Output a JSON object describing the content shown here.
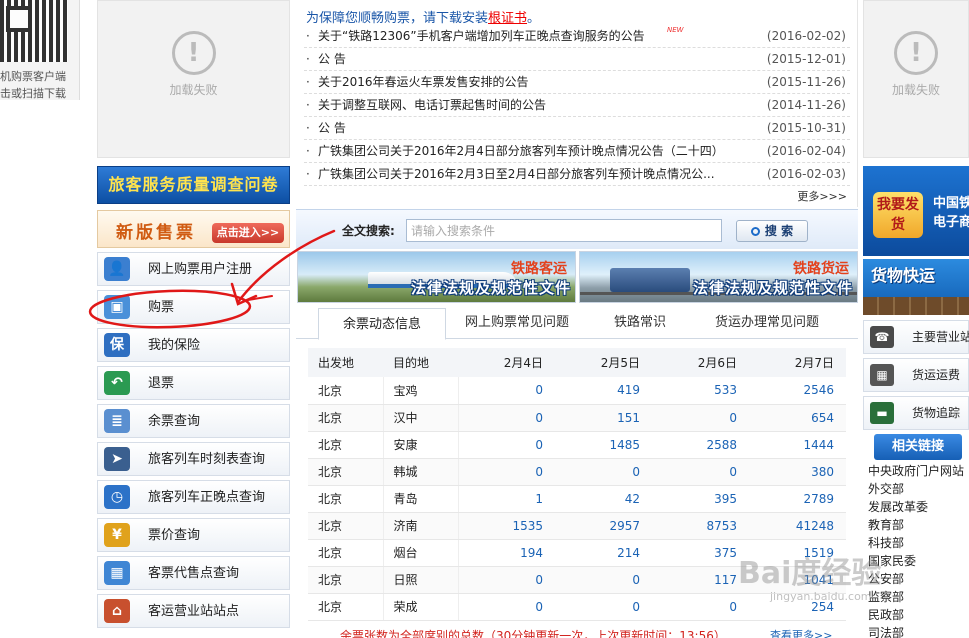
{
  "qr": {
    "line1": "机购票客户端",
    "line2": "击或扫描下载"
  },
  "load_failed": {
    "text": "加载失败",
    "glyph": "!"
  },
  "notice": {
    "headline_prefix": "为保障您顺畅购票，请下载安装",
    "headline_link": "根证书",
    "headline_suffix": "。",
    "items": [
      {
        "title": "关于“铁路12306”手机客户端增加列车正晚点查询服务的公告",
        "date": "(2016-02-02)",
        "new": "NEW"
      },
      {
        "title": "公 告",
        "date": "(2015-12-01)"
      },
      {
        "title": "关于2016年春运火车票发售安排的公告",
        "date": "(2015-11-26)"
      },
      {
        "title": "关于调整互联网、电话订票起售时间的公告",
        "date": "(2014-11-26)"
      },
      {
        "title": "公 告",
        "date": "(2015-10-31)"
      },
      {
        "title": "广铁集团公司关于2016年2月4日部分旅客列车预计晚点情况公告（二十四）",
        "date": "(2016-02-04)"
      },
      {
        "title": "广铁集团公司关于2016年2月3日至2月4日部分旅客列车预计晚点情况公...",
        "date": "(2016-02-03)"
      }
    ],
    "more": "更多>>>"
  },
  "survey_banner": "旅客服务质量调查问卷",
  "new_sell": {
    "title": "新版售票",
    "button": "点击进入>>"
  },
  "menu": [
    {
      "label": "网上购票用户注册",
      "icon": "user-register-icon",
      "color": "#3b7fd0"
    },
    {
      "label": "购票",
      "icon": "buy-ticket-icon",
      "color": "#4a90d9"
    },
    {
      "label": "我的保险",
      "icon": "insurance-shield-icon",
      "color": "#2f6fc1"
    },
    {
      "label": "退票",
      "icon": "refund-arrow-icon",
      "color": "#2b9a52"
    },
    {
      "label": "余票查询",
      "icon": "ticket-query-icon",
      "color": "#5a8fd0"
    },
    {
      "label": "旅客列车时刻表查询",
      "icon": "train-timetable-icon",
      "color": "#3a5f8f"
    },
    {
      "label": "旅客列车正晚点查询",
      "icon": "clock-icon",
      "color": "#2c72c8"
    },
    {
      "label": "票价查询",
      "icon": "yen-price-icon",
      "color": "#e0a21c"
    },
    {
      "label": "客票代售点查询",
      "icon": "ticket-agent-icon",
      "color": "#3f86d4"
    },
    {
      "label": "客运营业站站点",
      "icon": "station-house-icon",
      "color": "#c8502e"
    }
  ],
  "search": {
    "label": "全文搜索:",
    "placeholder": "请输入搜索条件",
    "button": "搜 索"
  },
  "legal_banners": [
    {
      "tag": "铁路客运",
      "caption": "法律法规及规范性文件"
    },
    {
      "tag": "铁路货运",
      "caption": "法律法规及规范性文件"
    }
  ],
  "tabs": [
    "余票动态信息",
    "网上购票常见问题",
    "铁路常识",
    "货运办理常见问题"
  ],
  "table": {
    "headers": [
      "出发地",
      "目的地",
      "2月4日",
      "2月5日",
      "2月6日",
      "2月7日"
    ],
    "rows": [
      [
        "北京",
        "宝鸡",
        "0",
        "419",
        "533",
        "2546"
      ],
      [
        "北京",
        "汉中",
        "0",
        "151",
        "0",
        "654"
      ],
      [
        "北京",
        "安康",
        "0",
        "1485",
        "2588",
        "1444"
      ],
      [
        "北京",
        "韩城",
        "0",
        "0",
        "0",
        "380"
      ],
      [
        "北京",
        "青岛",
        "1",
        "42",
        "395",
        "2789"
      ],
      [
        "北京",
        "济南",
        "1535",
        "2957",
        "8753",
        "41248"
      ],
      [
        "北京",
        "烟台",
        "194",
        "214",
        "375",
        "1519"
      ],
      [
        "北京",
        "日照",
        "0",
        "0",
        "117",
        "1041"
      ],
      [
        "北京",
        "荣成",
        "0",
        "0",
        "0",
        "254"
      ]
    ]
  },
  "footnote": "余票张数为全部席别的总数（30分钟更新一次，上次更新时间：13:56）",
  "more_view": "查看更多>>",
  "right": {
    "want": "我要发货",
    "china": "中国铁路\n电子商务",
    "fast": "货物快运",
    "items": [
      {
        "label": "主要营业站",
        "icon": "phone-icon",
        "color": "#4a4a4a"
      },
      {
        "label": "货运运费",
        "icon": "calculator-icon",
        "color": "#555"
      },
      {
        "label": "货物追踪",
        "icon": "locomotive-icon",
        "color": "#2a6f3a"
      }
    ],
    "related": "相关链接",
    "links": [
      "中央政府门户网站",
      "外交部",
      "发展改革委",
      "教育部",
      "科技部",
      "国家民委",
      "公安部",
      "监察部",
      "民政部",
      "司法部"
    ]
  },
  "watermark": {
    "main": "Bai度经验",
    "sub": "jingyan.baidu.com"
  }
}
